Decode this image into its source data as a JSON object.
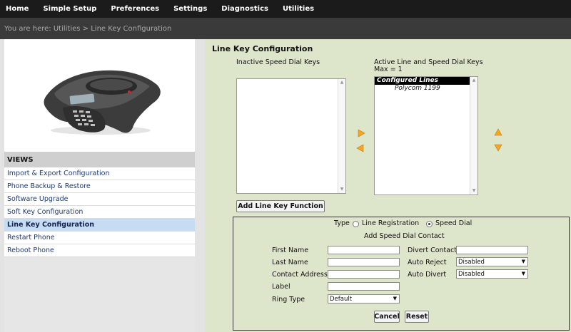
{
  "nav": {
    "items": [
      "Home",
      "Simple Setup",
      "Preferences",
      "Settings",
      "Diagnostics",
      "Utilities"
    ]
  },
  "breadcrumb": "You are here: Utilities > Line Key Configuration",
  "views": {
    "header": "VIEWS",
    "items": [
      "Import & Export Configuration",
      "Phone Backup & Restore",
      "Software Upgrade",
      "Soft Key Configuration",
      "Line Key Configuration",
      "Restart Phone",
      "Reboot Phone"
    ],
    "active_index": 4
  },
  "main": {
    "title": "Line Key Configuration",
    "inactive_label": "Inactive Speed Dial Keys",
    "active_label": "Active Line and Speed Dial Keys",
    "active_max": "Max = 1",
    "active_list": {
      "header": "Configured Lines",
      "items": [
        "Polycom 1199"
      ]
    },
    "add_button": "Add Line Key Function"
  },
  "form": {
    "type_label": "Type",
    "type_options": [
      "Line Registration",
      "Speed Dial"
    ],
    "type_selected": "Speed Dial",
    "section_title": "Add Speed Dial Contact",
    "first_name_label": "First Name",
    "last_name_label": "Last Name",
    "contact_address_label": "Contact Address",
    "label_label": "Label",
    "ring_type_label": "Ring Type",
    "ring_type_value": "Default",
    "divert_contact_label": "Divert Contact",
    "auto_reject_label": "Auto Reject",
    "auto_reject_value": "Disabled",
    "auto_divert_label": "Auto Divert",
    "auto_divert_value": "Disabled",
    "cancel_button": "Cancel",
    "reset_button": "Reset"
  },
  "colors": {
    "nav_bg": "#1b1b1b",
    "breadcrumb_bg": "#3a3a3a",
    "main_bg": "#dde5cb",
    "active_view_bg": "#c6dcf2",
    "arrow_orange": "#f5a623"
  }
}
